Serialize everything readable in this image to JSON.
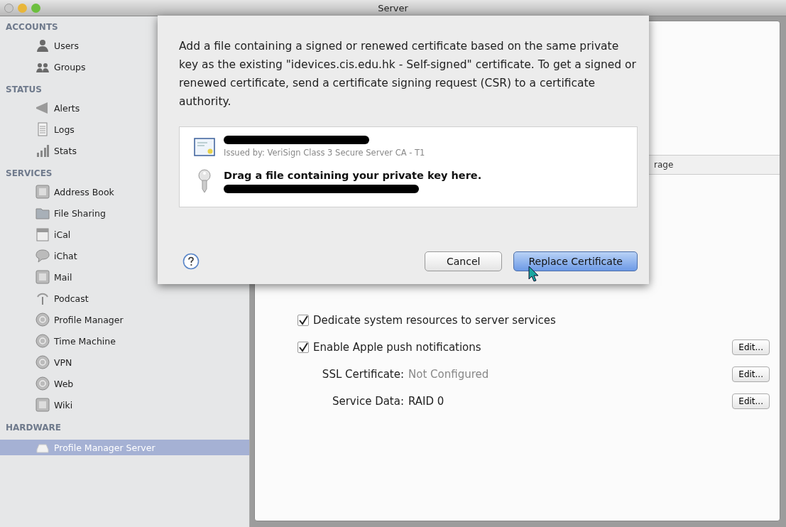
{
  "window": {
    "title": "Server"
  },
  "sidebar": {
    "sections": [
      {
        "title": "ACCOUNTS",
        "items": [
          {
            "label": "Users",
            "kind": "person",
            "selected": false
          },
          {
            "label": "Groups",
            "kind": "group",
            "selected": false
          }
        ]
      },
      {
        "title": "STATUS",
        "items": [
          {
            "label": "Alerts",
            "kind": "megaphone",
            "selected": false
          },
          {
            "label": "Logs",
            "kind": "document",
            "selected": false
          },
          {
            "label": "Stats",
            "kind": "bars",
            "selected": false
          }
        ]
      },
      {
        "title": "SERVICES",
        "items": [
          {
            "label": "Address Book",
            "kind": "square",
            "selected": false
          },
          {
            "label": "File Sharing",
            "kind": "folder",
            "selected": false
          },
          {
            "label": "iCal",
            "kind": "calendar",
            "selected": false
          },
          {
            "label": "iChat",
            "kind": "bubble",
            "selected": false
          },
          {
            "label": "Mail",
            "kind": "square",
            "selected": false
          },
          {
            "label": "Podcast",
            "kind": "antenna",
            "selected": false
          },
          {
            "label": "Profile Manager",
            "kind": "circle",
            "selected": false
          },
          {
            "label": "Time Machine",
            "kind": "circle",
            "selected": false
          },
          {
            "label": "VPN",
            "kind": "circle",
            "selected": false
          },
          {
            "label": "Web",
            "kind": "circle",
            "selected": false
          },
          {
            "label": "Wiki",
            "kind": "square",
            "selected": false
          }
        ]
      },
      {
        "title": "HARDWARE",
        "items": [
          {
            "label": "Profile Manager Server",
            "kind": "drive",
            "selected": true
          }
        ]
      }
    ]
  },
  "main": {
    "table_header": {
      "column_3": "rage"
    },
    "settings": [
      {
        "kind": "checkbox",
        "label": "Dedicate system resources to server services",
        "checked": true
      },
      {
        "kind": "checkbox",
        "label": "Enable Apple push notifications",
        "checked": true,
        "button": "Edit..."
      },
      {
        "kind": "field",
        "label": "SSL Certificate:",
        "value": "Not Configured",
        "dimmed": true,
        "button": "Edit..."
      },
      {
        "kind": "field",
        "label": "Service Data:",
        "value": "RAID 0",
        "dimmed": false,
        "button": "Edit..."
      }
    ]
  },
  "sheet": {
    "message": "Add a file containing a signed or renewed certificate based on the same private key as the existing \"idevices.cis.edu.hk - Self-signed\" certificate.  To get a signed or renewed certificate, send a certificate signing request (CSR) to a certificate authority.",
    "certificate": {
      "issuer": "Issued by: VeriSign Class 3 Secure Server CA - T1"
    },
    "key": {
      "prompt": "Drag a file containing your private key here."
    },
    "buttons": [
      {
        "label": "Cancel",
        "default": false
      },
      {
        "label": "Replace Certificate",
        "default": true
      }
    ]
  }
}
